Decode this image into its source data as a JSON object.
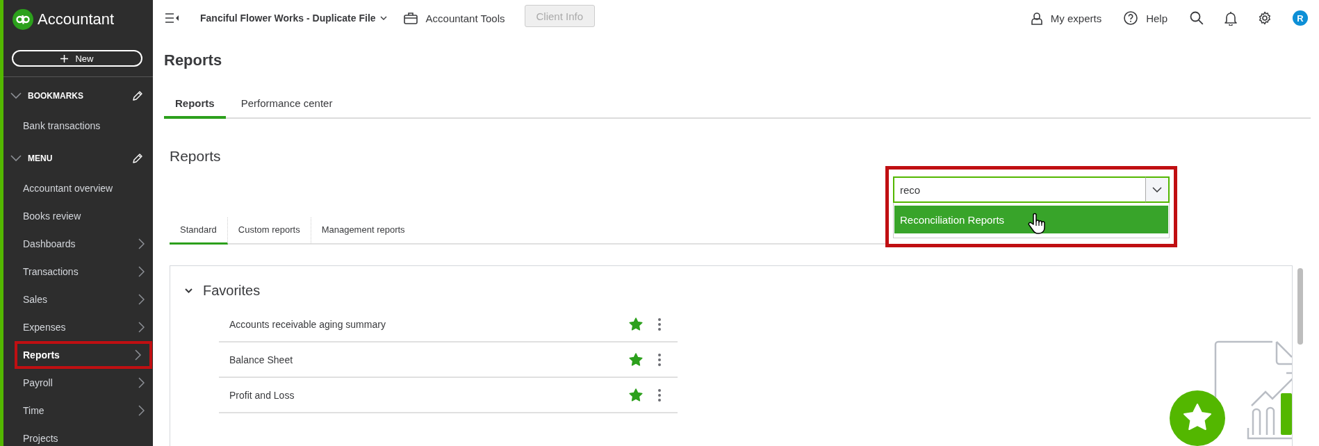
{
  "sidebar": {
    "logo_text": "Accountant",
    "new_button": "New",
    "sections": [
      {
        "title": "BOOKMARKS",
        "expanded": true,
        "items": [
          {
            "label": "Bank transactions",
            "selected": false,
            "has_submenu": false,
            "highlighted": false
          }
        ]
      },
      {
        "title": "MENU",
        "expanded": true,
        "items": [
          {
            "label": "Accountant overview",
            "selected": false,
            "has_submenu": false,
            "highlighted": false
          },
          {
            "label": "Books review",
            "selected": false,
            "has_submenu": false,
            "highlighted": false
          },
          {
            "label": "Dashboards",
            "selected": false,
            "has_submenu": true,
            "highlighted": false
          },
          {
            "label": "Transactions",
            "selected": false,
            "has_submenu": true,
            "highlighted": false
          },
          {
            "label": "Sales",
            "selected": false,
            "has_submenu": true,
            "highlighted": false
          },
          {
            "label": "Expenses",
            "selected": false,
            "has_submenu": true,
            "highlighted": false
          },
          {
            "label": "Reports",
            "selected": true,
            "has_submenu": true,
            "highlighted": true
          },
          {
            "label": "Payroll",
            "selected": false,
            "has_submenu": true,
            "highlighted": false
          },
          {
            "label": "Time",
            "selected": false,
            "has_submenu": true,
            "highlighted": false
          },
          {
            "label": "Projects",
            "selected": false,
            "has_submenu": false,
            "highlighted": false
          }
        ]
      }
    ]
  },
  "top_bar": {
    "company": "Fanciful Flower Works - Duplicate File",
    "tools": "Accountant Tools",
    "client_info": {
      "label": "Client Info",
      "disabled": true
    },
    "my_experts": "My experts",
    "help": "Help",
    "avatar": "R"
  },
  "page_title": "Reports",
  "tabs": [
    {
      "label": "Reports",
      "selected": true
    },
    {
      "label": "Performance center",
      "selected": false
    }
  ],
  "section_title": "Reports",
  "subtabs": [
    {
      "label": "Standard",
      "selected": true
    },
    {
      "label": "Custom reports",
      "selected": false
    },
    {
      "label": "Management reports",
      "selected": false
    }
  ],
  "search": {
    "value": "reco",
    "highlighted": true,
    "suggestions": [
      {
        "label": "Reconciliation Reports",
        "selected": true
      }
    ]
  },
  "favorites": {
    "title": "Favorites",
    "expanded": true,
    "rows": [
      {
        "name": "Accounts receivable aging summary",
        "favorite": true
      },
      {
        "name": "Balance Sheet",
        "favorite": true
      },
      {
        "name": "Profit and Loss",
        "favorite": true
      }
    ]
  }
}
